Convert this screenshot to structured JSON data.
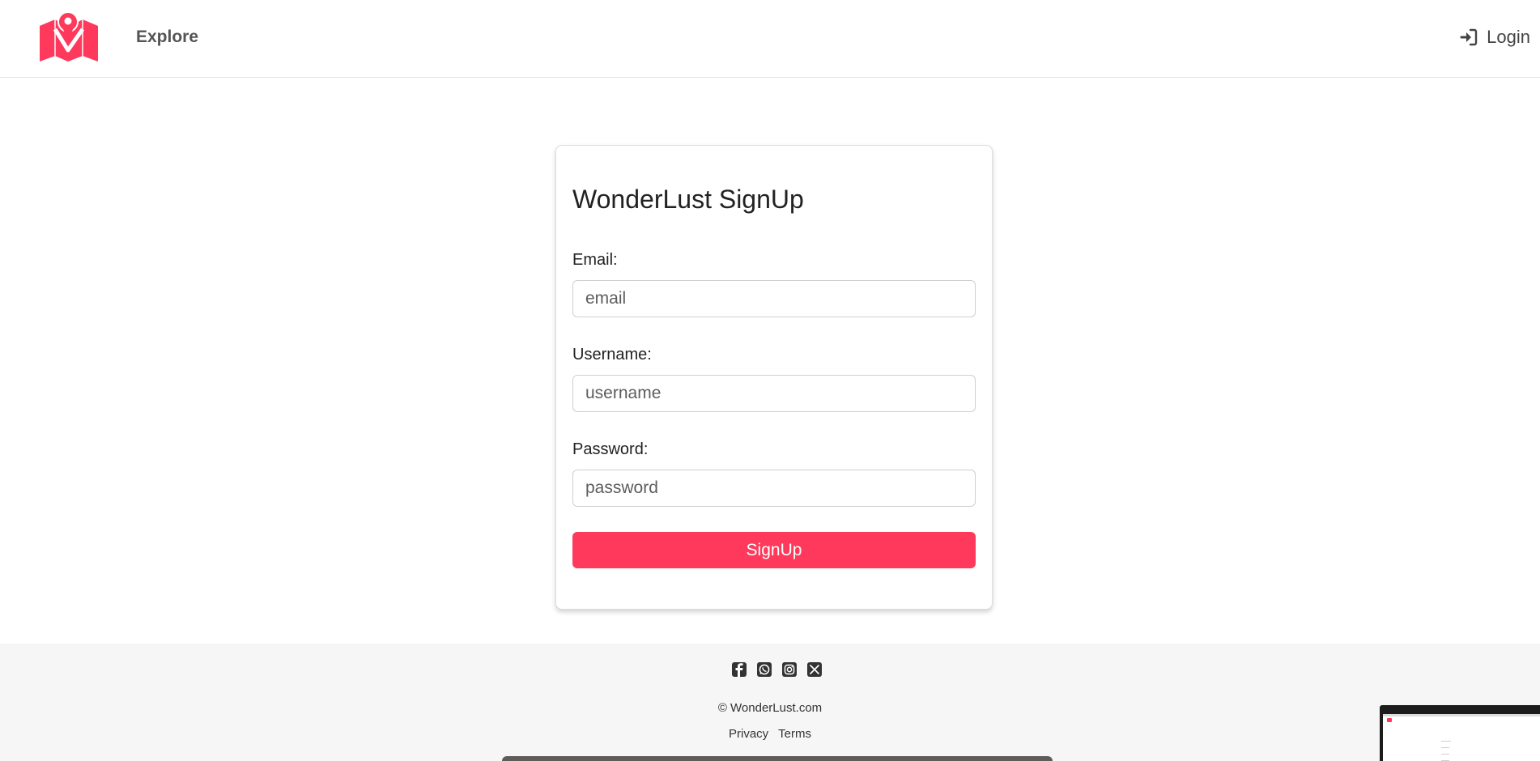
{
  "nav": {
    "logo_icon": "map-pin-logo",
    "explore_label": "Explore",
    "login_label": "Login",
    "login_icon": "sign-in-icon"
  },
  "form": {
    "title": "WonderLust SignUp",
    "email_label": "Email:",
    "email_placeholder": "email",
    "username_label": "Username:",
    "username_placeholder": "username",
    "password_label": "Password:",
    "password_placeholder": "password",
    "submit_label": "SignUp"
  },
  "footer": {
    "social_icons": [
      "facebook-icon",
      "whatsapp-icon",
      "instagram-icon",
      "x-icon"
    ],
    "copyright": "© WonderLust.com",
    "links": [
      "Privacy",
      "Terms"
    ]
  },
  "colors": {
    "brand": "#fe395c",
    "footer_bg": "#f6f6f6",
    "nav_text": "#555555"
  }
}
